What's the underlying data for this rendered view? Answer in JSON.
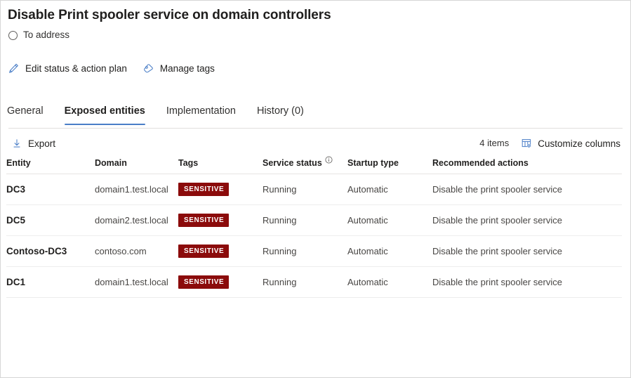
{
  "header": {
    "title": "Disable Print spooler service on domain controllers",
    "status": {
      "label": "To address",
      "icon": "radio-unchecked-icon"
    }
  },
  "commandbar": {
    "accent_color": "#4a7ec7",
    "actions": [
      {
        "label": "Edit status & action plan",
        "icon": "pencil-icon"
      },
      {
        "label": "Manage tags",
        "icon": "tag-icon"
      }
    ]
  },
  "tabs": {
    "underline_color": "#4a7ec7",
    "items": [
      {
        "label": "General",
        "selected": false
      },
      {
        "label": "Exposed entities",
        "selected": true
      },
      {
        "label": "Implementation",
        "selected": false
      },
      {
        "label": "History (0)",
        "selected": false
      }
    ]
  },
  "table_toolbar": {
    "export_label": "Export",
    "export_icon": "download-icon",
    "items_count": "4 items",
    "customize_columns_label": "Customize columns",
    "customize_columns_icon": "customize-columns-icon"
  },
  "table": {
    "columns": [
      {
        "label": "Entity"
      },
      {
        "label": "Domain"
      },
      {
        "label": "Tags"
      },
      {
        "label": "Service status",
        "info_icon": "info-icon"
      },
      {
        "label": "Startup type"
      },
      {
        "label": "Recommended actions"
      }
    ],
    "tag_badge_color": "#8b0b0b",
    "rows": [
      {
        "entity": "DC3",
        "domain": "domain1.test.local",
        "tag": "SENSITIVE",
        "service_status": "Running",
        "startup_type": "Automatic",
        "recommended_action": "Disable the print spooler service"
      },
      {
        "entity": "DC5",
        "domain": "domain2.test.local",
        "tag": "SENSITIVE",
        "service_status": "Running",
        "startup_type": "Automatic",
        "recommended_action": "Disable the print spooler service"
      },
      {
        "entity": "Contoso-DC3",
        "domain": "contoso.com",
        "tag": "SENSITIVE",
        "service_status": "Running",
        "startup_type": "Automatic",
        "recommended_action": "Disable the print spooler service"
      },
      {
        "entity": "DC1",
        "domain": "domain1.test.local",
        "tag": "SENSITIVE",
        "service_status": "Running",
        "startup_type": "Automatic",
        "recommended_action": "Disable the print spooler service"
      }
    ]
  }
}
